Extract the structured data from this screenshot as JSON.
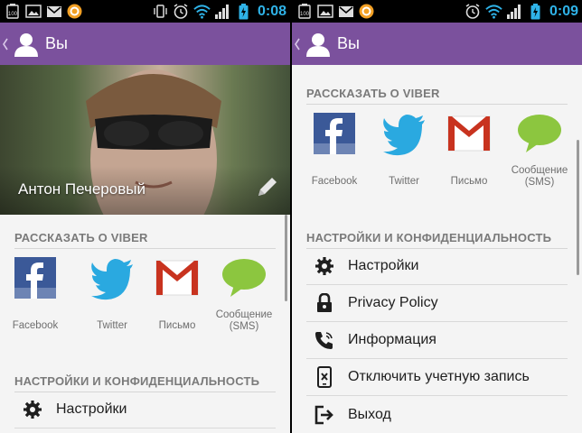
{
  "status_bar": {
    "battery_level": "100",
    "left_time": "0:08",
    "right_time": "0:09"
  },
  "header": {
    "title": "Вы"
  },
  "profile": {
    "name": "Антон Печеровый"
  },
  "share_section": {
    "title": "РАССКАЗАТЬ О VIBER",
    "items": [
      {
        "id": "facebook",
        "label": "Facebook"
      },
      {
        "id": "twitter",
        "label": "Twitter"
      },
      {
        "id": "email",
        "label": "Письмо"
      },
      {
        "id": "sms",
        "label": "Сообщение (SMS)"
      }
    ]
  },
  "settings_section": {
    "title": "НАСТРОЙКИ И КОНФИДЕНЦИАЛЬНОСТЬ",
    "items": [
      {
        "id": "settings",
        "label": "Настройки"
      },
      {
        "id": "privacy",
        "label": "Privacy Policy"
      },
      {
        "id": "info",
        "label": "Информация"
      },
      {
        "id": "deactivate",
        "label": "Отключить учетную запись"
      },
      {
        "id": "exit",
        "label": "Выход"
      }
    ]
  },
  "colors": {
    "header_bg": "#7b519d",
    "time_color": "#2fb3e8",
    "facebook_blue": "#3b5998",
    "twitter_blue": "#2aa9e0",
    "gmail_red": "#c8331f",
    "sms_green": "#8cc63f"
  }
}
